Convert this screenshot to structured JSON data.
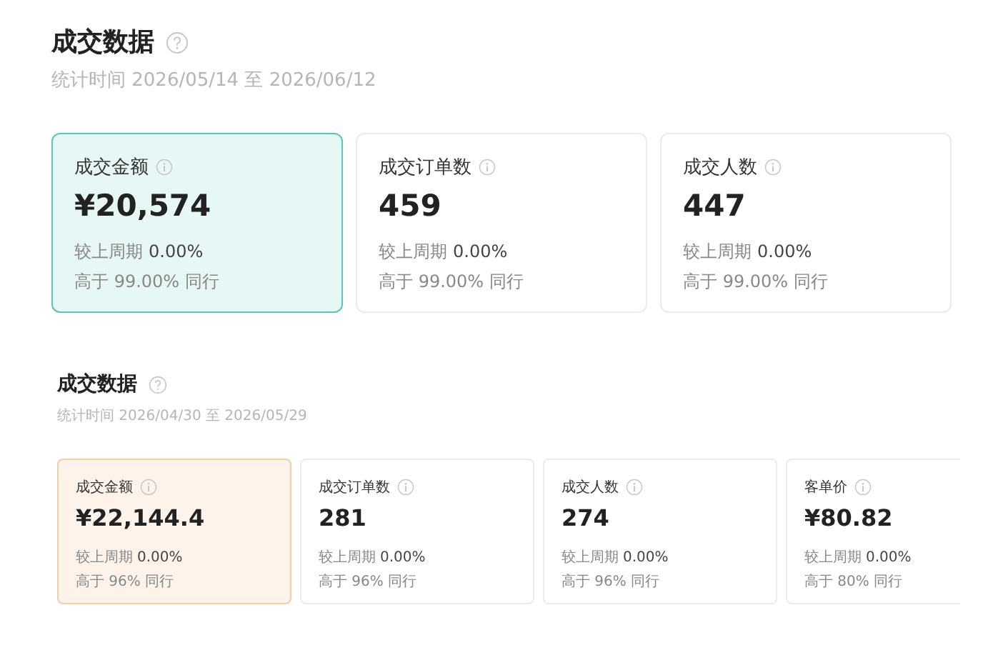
{
  "sections": [
    {
      "title": "成交数据",
      "period": "统计时间 2026/05/14 至 2026/06/12",
      "cards": [
        {
          "label": "成交金额",
          "value": "¥20,574",
          "compare_label": "较上周期",
          "compare_value": "0.00%",
          "peer": "高于 99.00% 同行",
          "selected": true
        },
        {
          "label": "成交订单数",
          "value": "459",
          "compare_label": "较上周期",
          "compare_value": "0.00%",
          "peer": "高于 99.00% 同行",
          "selected": false
        },
        {
          "label": "成交人数",
          "value": "447",
          "compare_label": "较上周期",
          "compare_value": "0.00%",
          "peer": "高于 99.00% 同行",
          "selected": false
        }
      ]
    },
    {
      "title": "成交数据",
      "period": "统计时间 2026/04/30 至 2026/05/29",
      "cards": [
        {
          "label": "成交金额",
          "value": "¥22,144.4",
          "compare_label": "较上周期",
          "compare_value": "0.00%",
          "peer": "高于 96% 同行",
          "selected": true
        },
        {
          "label": "成交订单数",
          "value": "281",
          "compare_label": "较上周期",
          "compare_value": "0.00%",
          "peer": "高于 96% 同行",
          "selected": false
        },
        {
          "label": "成交人数",
          "value": "274",
          "compare_label": "较上周期",
          "compare_value": "0.00%",
          "peer": "高于 96% 同行",
          "selected": false
        },
        {
          "label": "客单价",
          "value": "¥80.82",
          "compare_label": "较上周期",
          "compare_value": "0.00%",
          "peer": "高于 80% 同行",
          "selected": false
        }
      ]
    }
  ]
}
